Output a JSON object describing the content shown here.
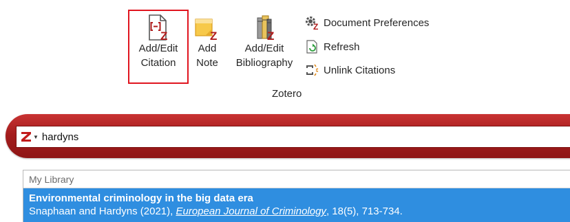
{
  "ribbon": {
    "group_label": "Zotero",
    "add_edit_citation": {
      "line1": "Add/Edit",
      "line2": "Citation",
      "icon": "document-citation-icon"
    },
    "add_note": {
      "line1": "Add",
      "line2": "Note",
      "icon": "note-icon"
    },
    "add_edit_bibliography": {
      "line1": "Add/Edit",
      "line2": "Bibliography",
      "icon": "books-icon"
    },
    "document_preferences": {
      "label": "Document Preferences",
      "icon": "gear-icon"
    },
    "refresh": {
      "label": "Refresh",
      "icon": "refresh-icon"
    },
    "unlink_citations": {
      "label": "Unlink Citations",
      "icon": "unlink-icon"
    }
  },
  "quick_format": {
    "search_value": "hardyns",
    "menu_icon": "zotero-z-icon",
    "colors": {
      "bar": "#a41d1d",
      "accent": "#e0141e"
    }
  },
  "results": {
    "library_header": "My Library",
    "items": [
      {
        "title": "Environmental criminology in the big data era",
        "authors_year": "Snaphaan and Hardyns (2021), ",
        "journal": "European Journal of Criminology",
        "volume_pages": ", 18(5), 713-734."
      }
    ],
    "colors": {
      "selected_bg": "#2f8ee0"
    }
  }
}
